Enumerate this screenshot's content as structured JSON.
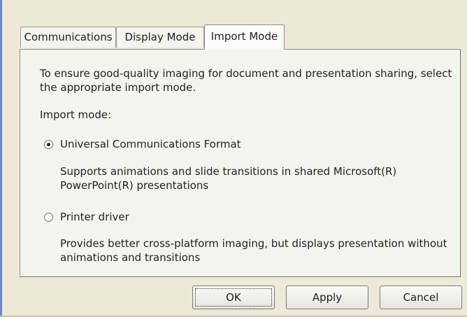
{
  "tabs": [
    {
      "label": "Communications"
    },
    {
      "label": "Display Mode"
    },
    {
      "label": "Import Mode"
    }
  ],
  "selected_tab": "Import Mode",
  "panel": {
    "description_line1": "To ensure good-quality imaging for document and presentation sharing, select",
    "description_line2": "the appropriate import mode.",
    "import_mode_label": "Import mode:",
    "options": [
      {
        "label": "Universal Communications Format",
        "selected": true,
        "desc_line1": "Supports animations and slide transitions in shared Microsoft(R)",
        "desc_line2": "PowerPoint(R) presentations"
      },
      {
        "label": "Printer driver",
        "selected": false,
        "desc_line1": "Provides better cross-platform imaging, but displays presentation without",
        "desc_line2": "animations and transitions"
      }
    ]
  },
  "buttons": {
    "ok": "OK",
    "apply": "Apply",
    "cancel": "Cancel"
  }
}
